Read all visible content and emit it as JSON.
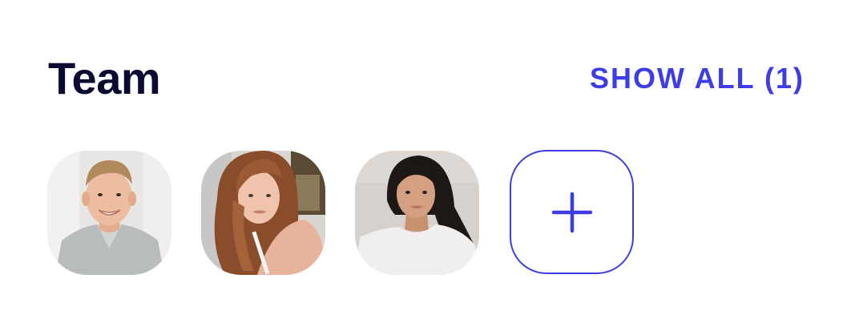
{
  "section": {
    "title": "Team",
    "show_all_label": "SHOW ALL (1)"
  },
  "members": [
    {
      "icon": "person-photo",
      "name": ""
    },
    {
      "icon": "person-photo",
      "name": ""
    },
    {
      "icon": "person-photo",
      "name": ""
    }
  ],
  "add_member": {
    "icon": "plus-icon"
  },
  "colors": {
    "title": "#0b0a33",
    "accent": "#3d3ce6",
    "background": "#ffffff"
  }
}
